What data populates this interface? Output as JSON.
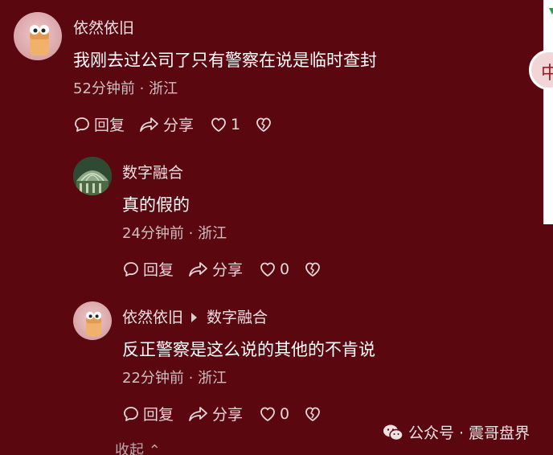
{
  "comments": [
    {
      "name": "依然依旧",
      "text": "我刚去过公司了只有警察在说是临时查封",
      "meta": "52分钟前 · 浙江",
      "reply_label": "回复",
      "share_label": "分享",
      "like_count": "1"
    },
    {
      "name": "数字融合",
      "text": "真的假的",
      "meta": "24分钟前 · 浙江",
      "reply_label": "回复",
      "share_label": "分享",
      "like_count": "0"
    },
    {
      "name": "依然依旧",
      "reply_to": "数字融合",
      "text": "反正警察是这么说的其他的不肯说",
      "meta": "22分钟前 · 浙江",
      "reply_label": "回复",
      "share_label": "分享",
      "like_count": "0"
    }
  ],
  "collapse_label": "收起",
  "watermark": {
    "text": "公众号 · 震哥盘界",
    "icon": "wechat-icon"
  },
  "side_avatar_glyph": "中",
  "icons": {
    "reply": "comment-bubble-icon",
    "share": "share-arrow-icon",
    "like": "heart-icon",
    "dislike": "broken-heart-icon",
    "collapse": "chevron-up-icon"
  },
  "colors": {
    "background": "#5b0710",
    "text": "#ffffff",
    "meta": "#cdbfc1"
  }
}
